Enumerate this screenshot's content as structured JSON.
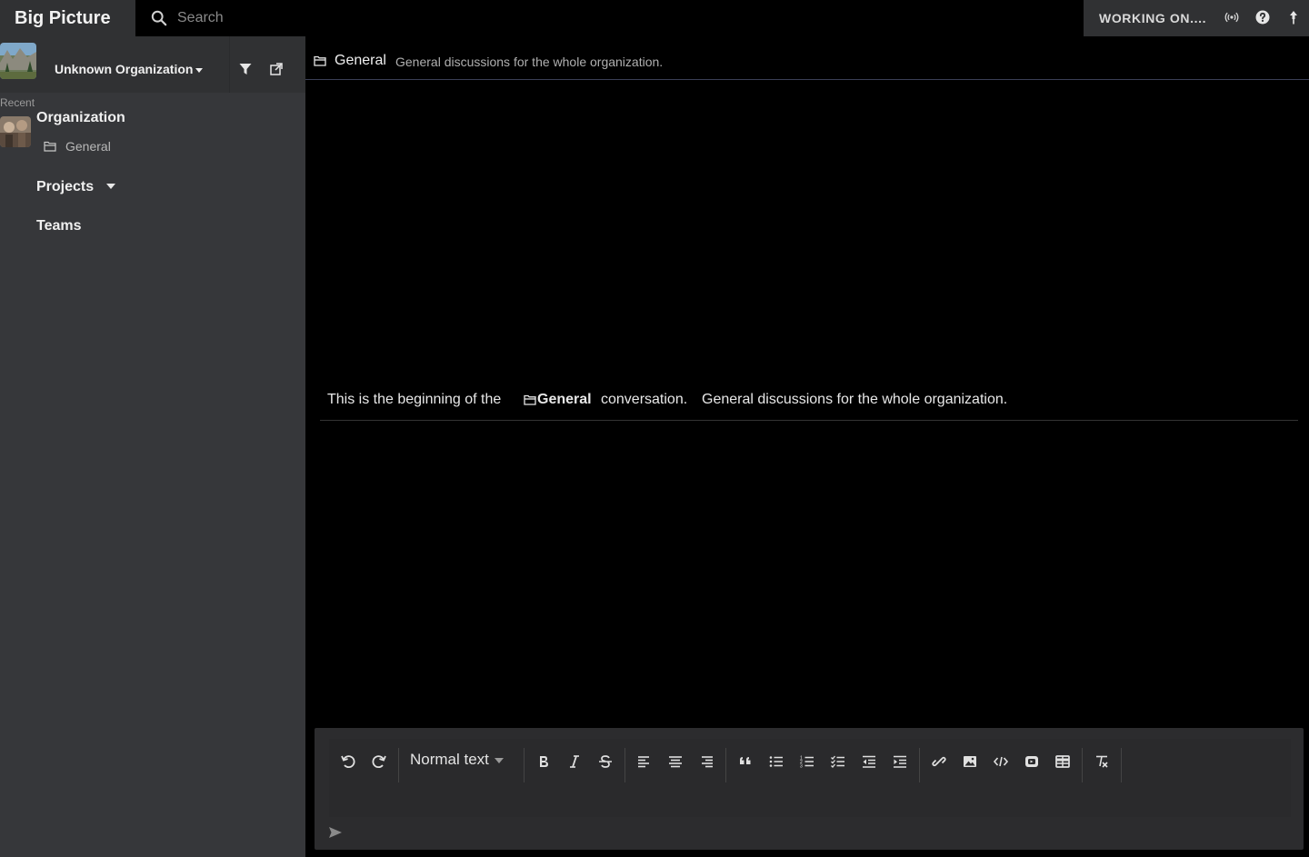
{
  "topbar": {
    "brand": "Big Picture",
    "search_placeholder": "Search",
    "status": "WORKING ON....",
    "icons": [
      "broadcast-icon",
      "help-icon",
      "pin-icon"
    ]
  },
  "sidebar": {
    "org_name": "Unknown Organization",
    "recent_label": "Recent",
    "recent_org": "Organization",
    "recent_channel": "General",
    "projects_label": "Projects",
    "teams_label": "Teams"
  },
  "channel": {
    "title": "General",
    "description": "General discussions for the whole organization."
  },
  "intro": {
    "prefix": "This is the beginning of the",
    "channel": "General",
    "suffix": "conversation.",
    "description": "General discussions for the whole organization."
  },
  "editor": {
    "block_type": "Normal text",
    "tools": [
      "undo",
      "redo",
      "bold",
      "italic",
      "strikethrough",
      "align-left",
      "align-center",
      "align-right",
      "blockquote",
      "bullet-list",
      "numbered-list",
      "checklist",
      "outdent",
      "indent",
      "link",
      "image",
      "code",
      "embed",
      "table",
      "clear-formatting"
    ]
  },
  "colors": {
    "topbar_bg": "#303133",
    "sidebar_bg": "#36373a",
    "main_bg": "#000000",
    "editor_bg": "#2c2c2e"
  }
}
